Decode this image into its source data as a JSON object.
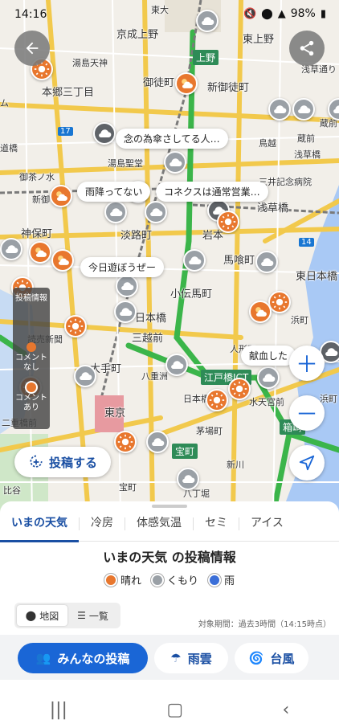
{
  "status_bar": {
    "time": "14:16",
    "battery": "98%"
  },
  "map": {
    "labels": [
      {
        "text": "京成上野",
        "cls": ""
      },
      {
        "text": "東上野",
        "cls": ""
      },
      {
        "text": "湯島天神",
        "cls": "small"
      },
      {
        "text": "御徒町",
        "cls": ""
      },
      {
        "text": "新御徒町",
        "cls": ""
      },
      {
        "text": "本郷三丁目",
        "cls": ""
      },
      {
        "text": "上野",
        "cls": "road-sign"
      },
      {
        "text": "鳥越",
        "cls": "small"
      },
      {
        "text": "浅草橋",
        "cls": "small"
      },
      {
        "text": "湯島聖堂",
        "cls": "small"
      },
      {
        "text": "御茶ノ水",
        "cls": "small"
      },
      {
        "text": "浅草橋",
        "cls": ""
      },
      {
        "text": "新御",
        "cls": "small"
      },
      {
        "text": "神保町",
        "cls": ""
      },
      {
        "text": "淡路町",
        "cls": ""
      },
      {
        "text": "岩本",
        "cls": ""
      },
      {
        "text": "馬喰町",
        "cls": ""
      },
      {
        "text": "東日本橋",
        "cls": ""
      },
      {
        "text": "小伝馬町",
        "cls": ""
      },
      {
        "text": "日本橋",
        "cls": ""
      },
      {
        "text": "三越前",
        "cls": ""
      },
      {
        "text": "浜町",
        "cls": "small"
      },
      {
        "text": "読売新聞",
        "cls": "small"
      },
      {
        "text": "大手町",
        "cls": ""
      },
      {
        "text": "八重洲",
        "cls": "small"
      },
      {
        "text": "人形町",
        "cls": "small"
      },
      {
        "text": "江戸橋JCT",
        "cls": "road-sign"
      },
      {
        "text": "日本橋",
        "cls": "small"
      },
      {
        "text": "水天宮前",
        "cls": "small"
      },
      {
        "text": "東京",
        "cls": ""
      },
      {
        "text": "箱崎",
        "cls": "road-sign"
      },
      {
        "text": "茅場町",
        "cls": "small"
      },
      {
        "text": "宝町",
        "cls": "road-sign"
      },
      {
        "text": "新川",
        "cls": "small"
      },
      {
        "text": "宝町",
        "cls": "small"
      },
      {
        "text": "八丁堀",
        "cls": "small"
      },
      {
        "text": "比谷",
        "cls": "small"
      },
      {
        "text": "浜町",
        "cls": "small"
      },
      {
        "text": "二重橋前",
        "cls": "small"
      },
      {
        "text": "蔵前",
        "cls": "small"
      },
      {
        "text": "蔵前",
        "cls": "small"
      },
      {
        "text": "17",
        "cls": "road-num"
      },
      {
        "text": "14",
        "cls": "road-num"
      },
      {
        "text": "東大",
        "cls": "small"
      },
      {
        "text": "浅草通り",
        "cls": "small"
      },
      {
        "text": "ム",
        "cls": "small"
      },
      {
        "text": "道橋",
        "cls": "small"
      },
      {
        "text": "三井記念病院",
        "cls": "small"
      }
    ],
    "bubbles": [
      "念の為傘さしてる人…",
      "雨降ってない",
      "コネクスは通常営業…",
      "今日遊ぼうぜー",
      "献血した"
    ],
    "legend_strip": {
      "title": "投稿情報",
      "items": [
        "コメントなし",
        "コメントあり"
      ]
    },
    "post_button": "投稿する"
  },
  "tabs": [
    "いまの天気",
    "冷房",
    "体感気温",
    "セミ",
    "アイス"
  ],
  "sheet": {
    "title": "いまの天気 の投稿情報",
    "legend": [
      {
        "label": "晴れ",
        "color": "#e8772e"
      },
      {
        "label": "くもり",
        "color": "#9aa0a6"
      },
      {
        "label": "雨",
        "color": "#3b6fd8"
      }
    ],
    "toggle": [
      "地図",
      "一覧"
    ],
    "period": "対象期間：過去3時間（14:15時点）"
  },
  "bottom_bar": {
    "primary": "みんなの投稿",
    "secondary": [
      "雨雲",
      "台風"
    ]
  }
}
